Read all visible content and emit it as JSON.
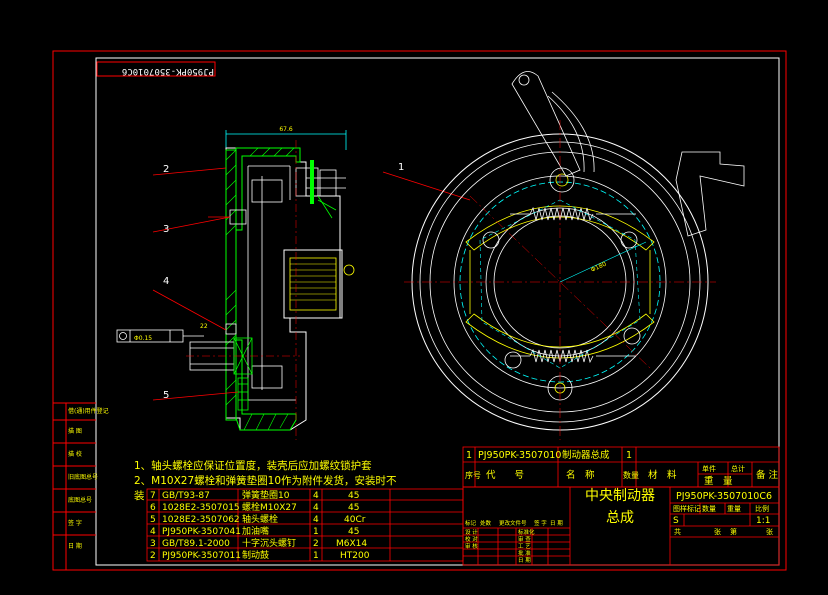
{
  "drawing_code_mirrored": "PJ950PK-3507010C6",
  "dimension_width": "67.6",
  "dimension_dia": "Φ180",
  "dim_small_a": "22",
  "dim_small_b": "Φ0.15",
  "part_callouts": [
    "1",
    "2",
    "3",
    "4",
    "5"
  ],
  "notes": [
    "1、轴头螺栓应保证位置度，装壳后应加螺纹锁护套",
    "2、M10X27螺栓和弹簧垫圈10作为附件发货，安装时不",
    "装"
  ],
  "left_strip_labels": [
    "借(通)用件登记",
    "描 图",
    "描 校",
    "旧底图总号",
    "底图总号",
    "签 字",
    "日 期"
  ],
  "bom_rows": [
    {
      "no": "7",
      "code": "GB/T93-87",
      "name": "弹簧垫圈10",
      "qty": "4",
      "mat": "45"
    },
    {
      "no": "6",
      "code": "1028E2-3507015",
      "name": "螺栓M10X27",
      "qty": "4",
      "mat": "45"
    },
    {
      "no": "5",
      "code": "1028E2-3507062",
      "name": "轴头螺栓",
      "qty": "4",
      "mat": "40Cr"
    },
    {
      "no": "4",
      "code": "PJ950PK-3507041",
      "name": "加油嘴",
      "qty": "1",
      "mat": "45"
    },
    {
      "no": "3",
      "code": "GB/T89.1-2000",
      "name": "十字沉头螺钉",
      "qty": "2",
      "mat": "M6X14"
    },
    {
      "no": "2",
      "code": "PJ950PK-3507011",
      "name": "制动鼓",
      "qty": "1",
      "mat": "HT200"
    }
  ],
  "bom_header_row": {
    "no": "1",
    "code": "PJ950PK-3507010",
    "name": "制动器总成",
    "qty": "1"
  },
  "bom_header": {
    "seq": "序号",
    "code": "代　　号",
    "name": "名　称",
    "qty": "数量",
    "mat": "材　料",
    "unit_weight": "单件",
    "total_weight": "总计",
    "weight": "重　量",
    "remark": "备 注"
  },
  "title_name": [
    "中央制动器",
    "总成"
  ],
  "title_code": "PJ950PK-3507010C6",
  "title_stage_labels": [
    "图样标记",
    "数量",
    "重量",
    "比例"
  ],
  "title_mark": "S",
  "title_scale": "1:1",
  "title_sheets": [
    "共",
    "张",
    "第",
    "张"
  ],
  "sign_header": [
    "标记",
    "处数",
    "更改文件号",
    "签 字",
    "日 期"
  ],
  "sign_rows": [
    [
      "设 计",
      "标准化"
    ],
    [
      "校 对",
      "审 查"
    ],
    [
      "审 核",
      "工 艺"
    ],
    [
      "",
      "批 准"
    ],
    [
      "",
      "日 期"
    ]
  ],
  "colors": {
    "frame": "#ff0000",
    "line": "#ffffff",
    "text": "#ffff00",
    "hatch": "#00ff00",
    "dim": "#00ffff",
    "spring": "#ffffff"
  }
}
